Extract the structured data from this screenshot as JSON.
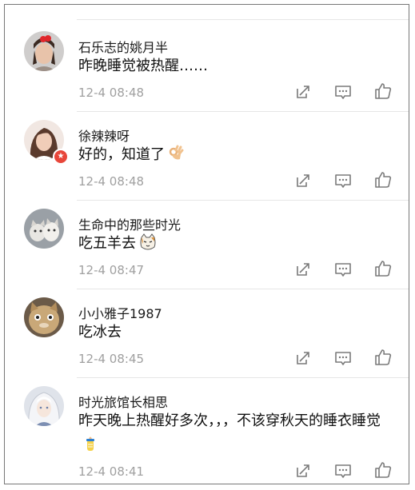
{
  "comments": [
    {
      "username": "石乐志的姚月半",
      "text": "昨晚睡觉被热醒……",
      "time": "12-4 08:48",
      "avatar_icon": "girl-red-bow-avatar"
    },
    {
      "username": "徐辣辣呀",
      "text": "好的，知道了",
      "emoji": "ok-hand-emoji",
      "time": "12-4 08:48",
      "avatar_icon": "girl-selfie-avatar",
      "verified_badge": true
    },
    {
      "username": "生命中的那些时光",
      "text": "吃五羊去",
      "emoji": "cat-face-emoji",
      "time": "12-4 08:47",
      "avatar_icon": "cats-avatar"
    },
    {
      "username": "小小雅子1987",
      "text": "吃冰去",
      "time": "12-4 08:45",
      "avatar_icon": "cat-meme-avatar"
    },
    {
      "username": "时光旅馆长相思",
      "text": "昨天晚上热醒好多次，，，不该穿秋天的睡衣睡觉",
      "emoji": "baby-bottle-emoji",
      "time": "12-4 08:41",
      "avatar_icon": "anime-white-hair-avatar"
    }
  ],
  "actions": [
    "share-icon",
    "comment-icon",
    "like-icon"
  ],
  "colors": {
    "text": "#111111",
    "meta": "#a0a0a0",
    "divider": "#e6e6e6",
    "badge": "#e8463a"
  }
}
